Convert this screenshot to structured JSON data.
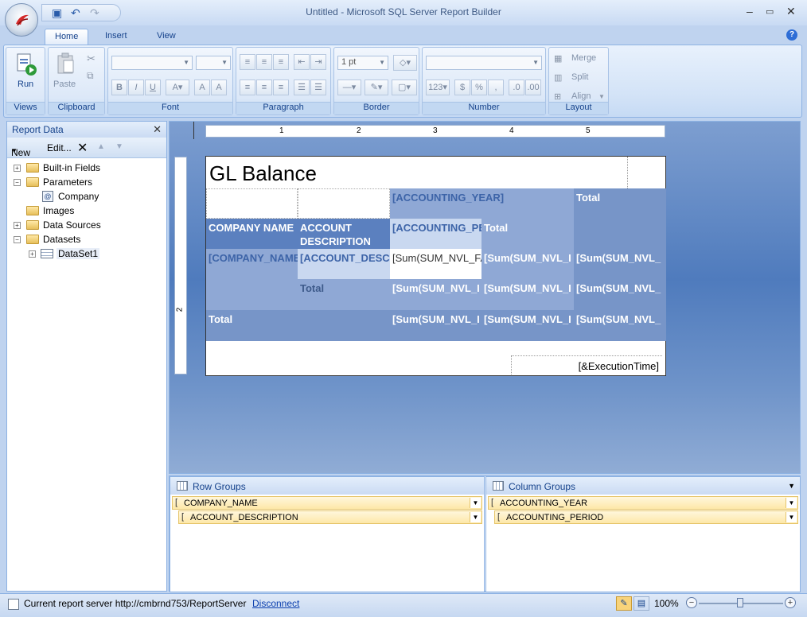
{
  "window": {
    "title": "Untitled - Microsoft SQL Server Report Builder"
  },
  "tabs": [
    {
      "label": "Home"
    },
    {
      "label": "Insert"
    },
    {
      "label": "View"
    }
  ],
  "ribbon": {
    "views": {
      "run_label": "Run",
      "group_label": "Views"
    },
    "clipboard": {
      "paste_label": "Paste",
      "group_label": "Clipboard"
    },
    "font": {
      "group_label": "Font"
    },
    "paragraph": {
      "group_label": "Paragraph"
    },
    "border": {
      "width_value": "1 pt",
      "group_label": "Border"
    },
    "number": {
      "group_label": "Number"
    },
    "layout": {
      "merge_label": "Merge",
      "split_label": "Split",
      "align_label": "Align",
      "group_label": "Layout"
    }
  },
  "report_data": {
    "title": "Report Data",
    "toolbar": {
      "new_label": "New",
      "edit_label": "Edit..."
    },
    "tree": [
      {
        "label": "Built-in Fields"
      },
      {
        "label": "Parameters"
      },
      {
        "label": "Company"
      },
      {
        "label": "Images"
      },
      {
        "label": "Data Sources"
      },
      {
        "label": "Datasets"
      },
      {
        "label": "DataSet1"
      }
    ]
  },
  "ruler": {
    "marks": [
      "1",
      "2",
      "3",
      "4",
      "5"
    ],
    "v_mark": "2"
  },
  "report": {
    "title": "GL Balance",
    "cells": {
      "year": "[ACCOUNTING_YEAR]",
      "total_top": "Total",
      "company_hdr": "COMPANY NAME",
      "account_hdr": "ACCOUNT DESCRIPTION",
      "period": "[ACCOUNTING_PE",
      "total_period": "Total",
      "company_val": "[COMPANY_NAME",
      "account_val": "[ACCOUNT_DESCR",
      "sum_fa": "[Sum(SUM_NVL_FA",
      "sum1": "[Sum(SUM_NVL_I",
      "sum2": "[Sum(SUM_NVL_",
      "total_acct": "Total",
      "sum3": "[Sum(SUM_NVL_I",
      "sum4": "[Sum(SUM_NVL_I",
      "sum5": "[Sum(SUM_NVL_",
      "total_bottom": "Total",
      "sum6": "[Sum(SUM_NVL_I",
      "sum7": "[Sum(SUM_NVL_I",
      "sum8": "[Sum(SUM_NVL_"
    },
    "execution_time": "[&ExecutionTime]"
  },
  "row_groups": {
    "title": "Row Groups",
    "items": [
      "COMPANY_NAME",
      "ACCOUNT_DESCRIPTION"
    ]
  },
  "column_groups": {
    "title": "Column Groups",
    "items": [
      "ACCOUNTING_YEAR",
      "ACCOUNTING_PERIOD"
    ]
  },
  "status": {
    "server_text": "Current report server http://cmbrnd753/ReportServer",
    "disconnect_label": "Disconnect",
    "zoom": "100%"
  }
}
